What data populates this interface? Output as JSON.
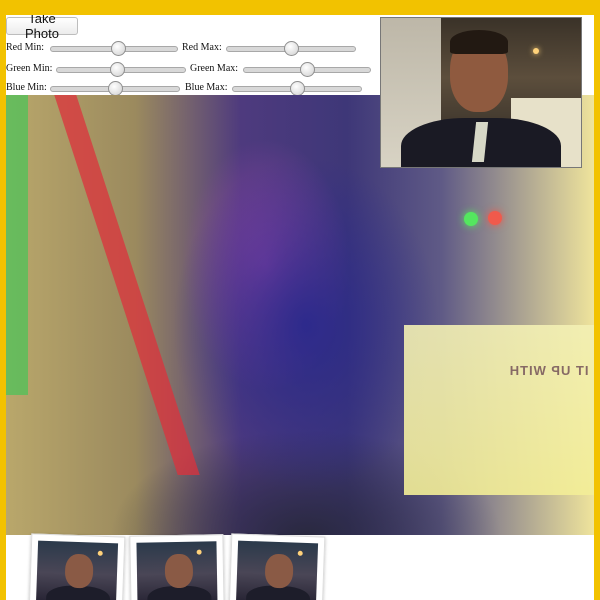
{
  "controls": {
    "take_photo_label": "Take Photo",
    "sliders": [
      {
        "label": "Red Min:",
        "value": 0.53
      },
      {
        "label": "Red Max:",
        "value": 0.5
      },
      {
        "label": "Green Min:",
        "value": 0.47
      },
      {
        "label": "Green Max:",
        "value": 0.5
      },
      {
        "label": "Blue Min:",
        "value": 0.5
      },
      {
        "label": "Blue Max:",
        "value": 0.5
      }
    ]
  },
  "preview": {
    "mirror_text": "LIVE IT UP WITH"
  },
  "photos": {
    "count": 3
  },
  "colors": {
    "frame": "#f2c200",
    "slider_thumb": "#cfcfcf"
  }
}
